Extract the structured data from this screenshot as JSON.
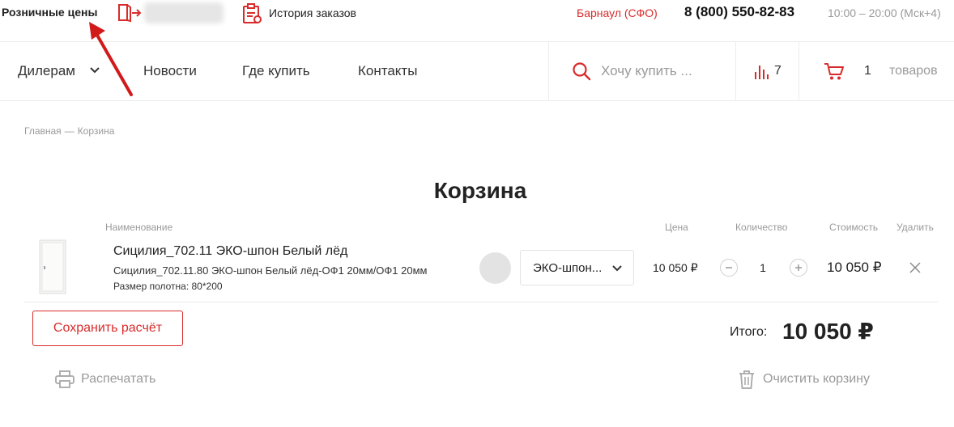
{
  "topbar": {
    "retail_prices": "Розничные цены",
    "order_history": "История заказов",
    "city": "Барнаул (СФО)",
    "phone": "8 (800) 550-82-83",
    "hours": "10:00 – 20:00 (Мск+4)"
  },
  "nav": {
    "dealers": "Дилерам",
    "news": "Новости",
    "where_to_buy": "Где купить",
    "contacts": "Контакты",
    "search_placeholder": "Хочу купить ...",
    "compare_count": "7",
    "cart_count": "1",
    "cart_label": "товаров"
  },
  "breadcrumb": {
    "home": "Главная",
    "separator": "—",
    "current": "Корзина"
  },
  "page_title": "Корзина",
  "table": {
    "headers": {
      "name": "Наименование",
      "price": "Цена",
      "quantity": "Количество",
      "cost": "Стоимость",
      "delete": "Удалить"
    },
    "rows": [
      {
        "title": "Сицилия_702.11 ЭКО-шпон Белый лёд",
        "subtitle": "Сицилия_702.11.80 ЭКО-шпон Белый лёд-ОФ1 20мм/ОФ1 20мм",
        "size": "Размер полотна: 80*200",
        "material": "ЭКО-шпон...",
        "price": "10 050 ₽",
        "quantity": "1",
        "cost": "10 050 ₽"
      }
    ]
  },
  "actions": {
    "save": "Сохранить расчёт",
    "total_label": "Итого:",
    "total_value": "10 050 ₽",
    "print": "Распечатать",
    "clear": "Очистить корзину"
  },
  "colors": {
    "accent": "#d92b2b",
    "muted": "#9a9a9a",
    "text": "#222222",
    "border": "#ececec"
  },
  "icons": [
    "logout-icon",
    "order-history-icon",
    "chevron-down-icon",
    "search-icon",
    "compare-icon",
    "cart-icon",
    "minus-icon",
    "plus-icon",
    "close-icon",
    "print-icon",
    "trash-icon",
    "annotation-arrow"
  ]
}
